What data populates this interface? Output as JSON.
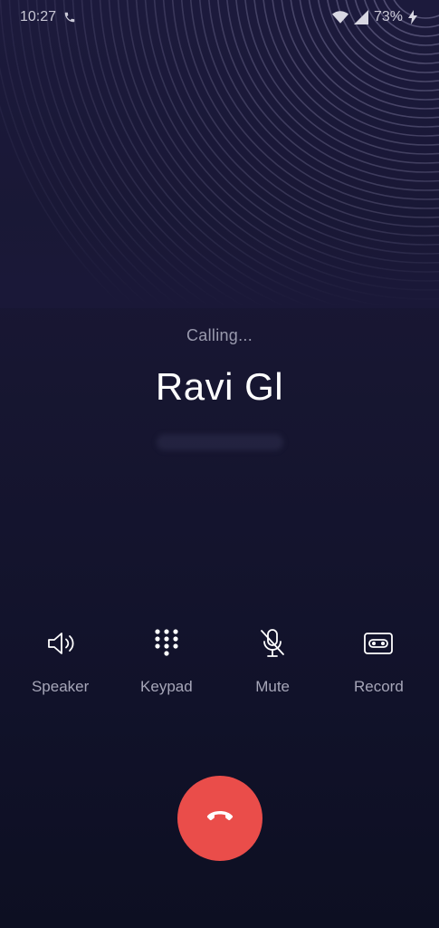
{
  "status_bar": {
    "time": "10:27",
    "battery_percent": "73%",
    "icons": [
      "phone-call-icon",
      "wifi-icon",
      "signal-icon",
      "charging-icon"
    ]
  },
  "call": {
    "status": "Calling...",
    "contact_name": "Ravi Gl"
  },
  "controls": [
    {
      "label": "Speaker",
      "icon": "speaker-icon"
    },
    {
      "label": "Keypad",
      "icon": "keypad-icon"
    },
    {
      "label": "Mute",
      "icon": "mute-icon"
    },
    {
      "label": "Record",
      "icon": "record-icon"
    }
  ],
  "end_call": {
    "icon": "end-call-icon",
    "color": "#ea4d4a"
  },
  "colors": {
    "background_top": "#1c1a3c",
    "background_bottom": "#0d0f22",
    "accent_end_call": "#ea4d4a"
  }
}
